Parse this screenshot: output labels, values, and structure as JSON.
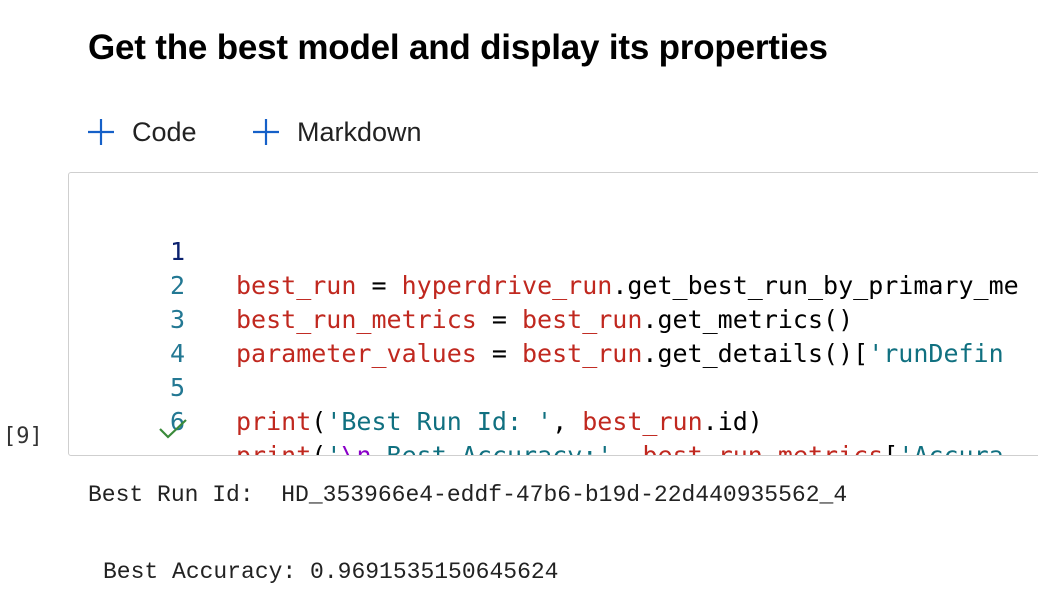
{
  "heading": "Get the best model and display its properties",
  "toolbar": {
    "add_code_label": "Code",
    "add_markdown_label": "Markdown"
  },
  "cell": {
    "execution_count": "[9]",
    "status": "success",
    "lines": [
      {
        "number": "1",
        "code": "best_run = hyperdrive_run.get_best_run_by_primary_me"
      },
      {
        "number": "2",
        "code": "best_run_metrics = best_run.get_metrics()"
      },
      {
        "number": "3",
        "code": "parameter_values = best_run.get_details()['runDefin"
      },
      {
        "number": "4",
        "code": ""
      },
      {
        "number": "5",
        "code": "print('Best Run Id: ', best_run.id)"
      },
      {
        "number": "6",
        "code": "print('\\n Best Accuracy:', best_run_metrics['Accura"
      }
    ]
  },
  "output": {
    "line1": "Best Run Id:  HD_353966e4-eddf-47b6-b19d-22d440935562_4",
    "line2": "Best Accuracy: 0.9691535150645624"
  },
  "colors": {
    "variable": "#c0281f",
    "string": "#107080",
    "escape": "#8a00c8",
    "line_number": "#237893",
    "plus_icon": "#1560c8",
    "check_icon": "#3a8a3a"
  }
}
